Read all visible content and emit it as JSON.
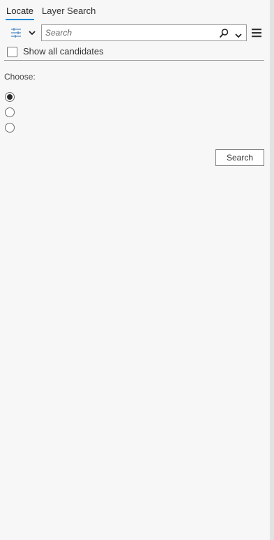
{
  "tabs": [
    {
      "label": "Locate",
      "active": true
    },
    {
      "label": "Layer Search",
      "active": false
    }
  ],
  "toolbar": {
    "filter_icon": "filter-sliders-icon",
    "search_placeholder": "Search",
    "search_value": "",
    "search_icon": "magnifier-icon",
    "menu_icon": "hamburger-menu-icon"
  },
  "options": {
    "show_all_candidates_label": "Show all candidates",
    "show_all_candidates_checked": false
  },
  "choose": {
    "label": "Choose:",
    "radio_count": 3,
    "selected_index": 0
  },
  "actions": {
    "search_button_label": "Search"
  },
  "colors": {
    "accent": "#1f8ad6",
    "background": "#f7f7f7",
    "filter_icon": "#4a86c5"
  }
}
